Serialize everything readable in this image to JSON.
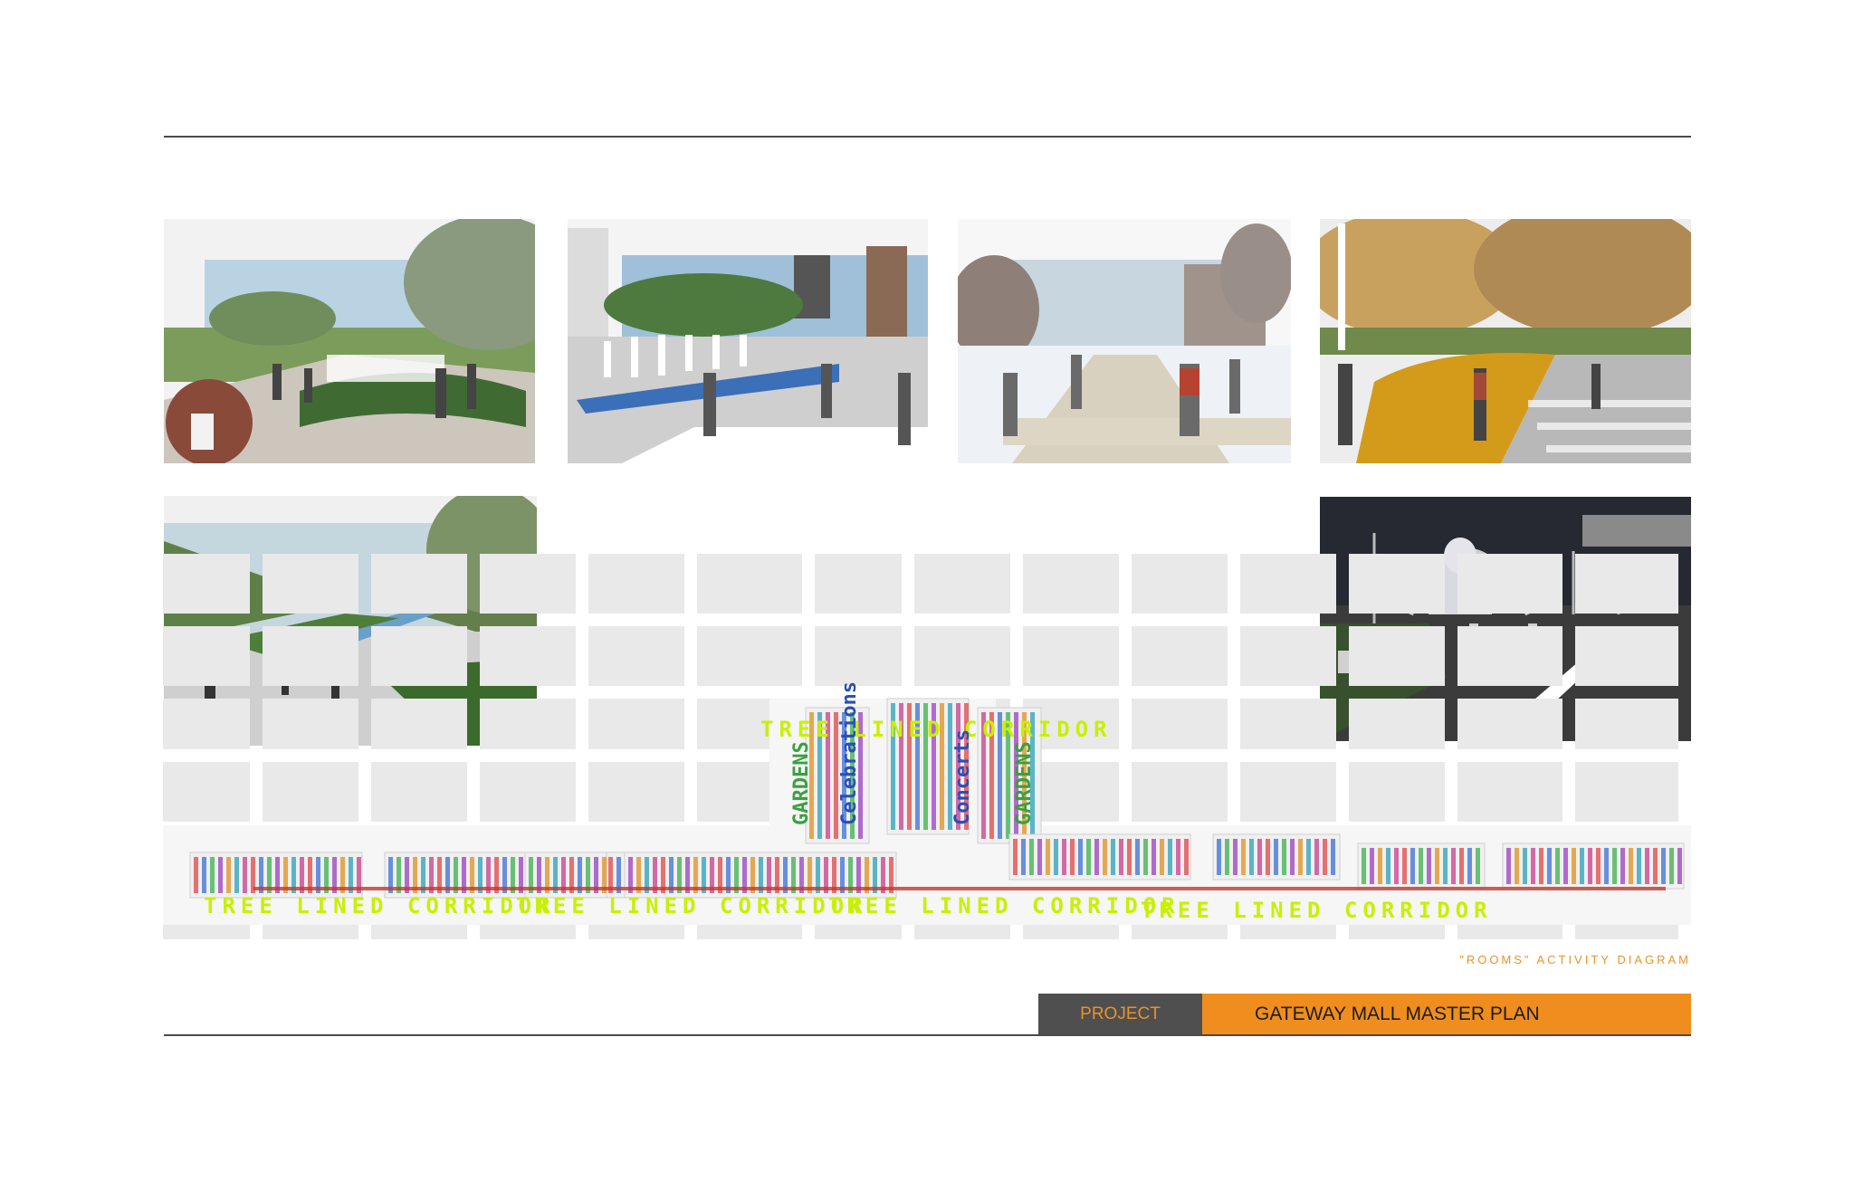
{
  "plan": {
    "corridor_label": "TREE LINED CORRIDOR",
    "room_labels": [
      "GARDENS",
      "Celebrations",
      "Concerts",
      "GARDENS"
    ]
  },
  "caption": "\"ROOMS\" ACTIVITY DIAGRAM",
  "footer": {
    "project_label": "PROJECT",
    "project_title": "GATEWAY MALL MASTER PLAN"
  },
  "colors": {
    "accent_orange": "#ef8e1e",
    "footer_dark": "#4f4f4f",
    "corridor_green": "#c8f000",
    "plan_block": "#e6e6e6"
  }
}
